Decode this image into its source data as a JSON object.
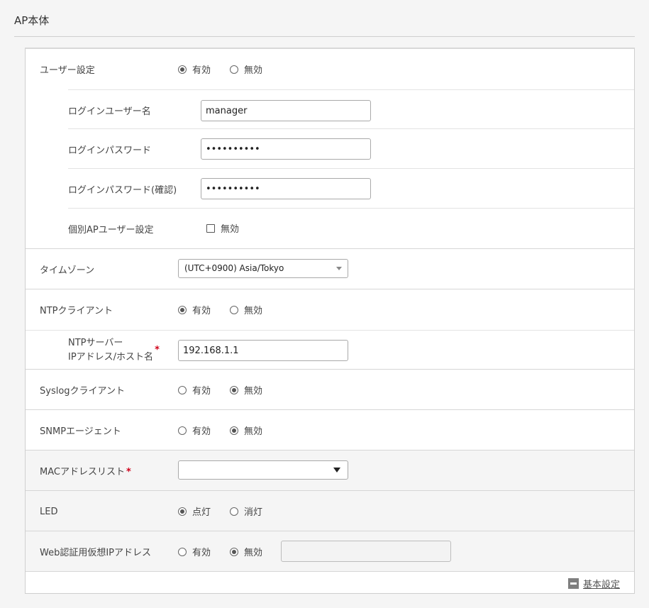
{
  "section_title": "AP本体",
  "user_setting": {
    "label": "ユーザー設定",
    "options": [
      "有効",
      "無効"
    ],
    "selected": 0
  },
  "login_user": {
    "label": "ログインユーザー名",
    "value": "manager"
  },
  "login_password": {
    "label": "ログインパスワード",
    "value": "••••••••••"
  },
  "login_password_confirm": {
    "label": "ログインパスワード(確認)",
    "value": "••••••••••"
  },
  "individual_ap_user": {
    "label": "個別APユーザー設定",
    "checkbox_label": "無効",
    "checked": false
  },
  "timezone": {
    "label": "タイムゾーン",
    "value": "(UTC+0900) Asia/Tokyo"
  },
  "ntp_client": {
    "label": "NTPクライアント",
    "options": [
      "有効",
      "無効"
    ],
    "selected": 0
  },
  "ntp_server": {
    "label_line1": "NTPサーバー",
    "label_line2": "IPアドレス/ホスト名",
    "required_mark": "*",
    "value": "192.168.1.1"
  },
  "syslog_client": {
    "label": "Syslogクライアント",
    "options": [
      "有効",
      "無効"
    ],
    "selected": 1
  },
  "snmp_agent": {
    "label": "SNMPエージェント",
    "options": [
      "有効",
      "無効"
    ],
    "selected": 1
  },
  "mac_list": {
    "label": "MACアドレスリスト",
    "required_mark": "*",
    "value": ""
  },
  "led": {
    "label": "LED",
    "options": [
      "点灯",
      "消灯"
    ],
    "selected": 0
  },
  "web_auth_ip": {
    "label": "Web認証用仮想IPアドレス",
    "options": [
      "有効",
      "無効"
    ],
    "selected": 1,
    "value": ""
  },
  "footer": {
    "link_label": "基本設定"
  }
}
